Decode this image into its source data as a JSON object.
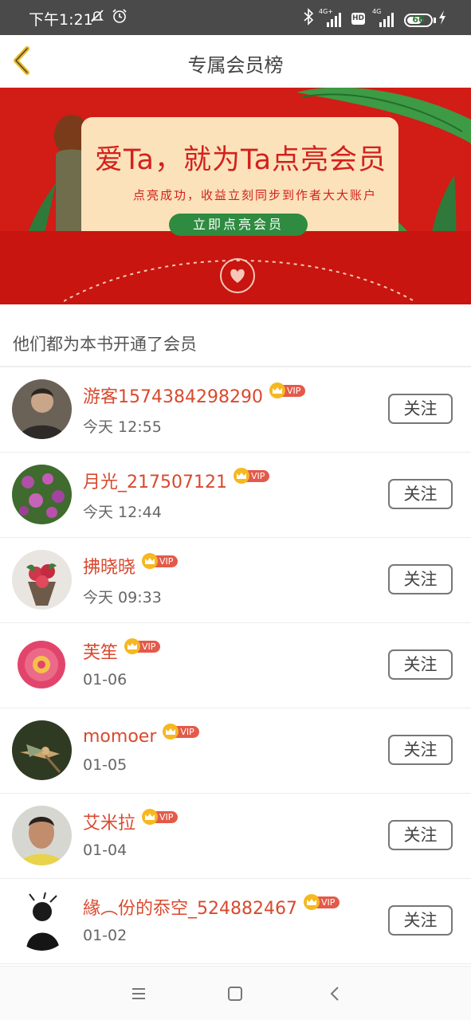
{
  "status_bar": {
    "time": "下午1:21",
    "net_1": "4G+",
    "net_2": "4G",
    "hd": "HD",
    "battery": "66",
    "battery_level": 0.66
  },
  "header": {
    "title": "专属会员榜"
  },
  "banner": {
    "headline": "爱Ta，就为Ta点亮会员",
    "subline": "点亮成功，收益立刻同步到作者大大账户",
    "cta": "立即点亮会员"
  },
  "section_title": "他们都为本书开通了会员",
  "vip_label": "VIP",
  "follow_label": "关注",
  "members": [
    {
      "name": "游客1574384298290",
      "time": "今天 12:55"
    },
    {
      "name": "月光_217507121",
      "time": "今天 12:44"
    },
    {
      "name": "拂晓晓",
      "time": "今天 09:33"
    },
    {
      "name": "芙笙",
      "time": "01-06"
    },
    {
      "name": "momoer",
      "time": "01-05"
    },
    {
      "name": "艾米拉",
      "time": "01-04"
    },
    {
      "name": "緣︵份的忝空_524882467",
      "time": "01-02"
    }
  ],
  "colors": {
    "accent_name": "#d9492e",
    "banner_red": "#d21c16",
    "back_arrow": "#e8b923",
    "cta_green": "#2e8b3f",
    "vip_badge": "#e35a4a",
    "crown": "#f5b820"
  },
  "icons": {
    "back": "chevron-left-icon",
    "bluetooth": "bluetooth-icon",
    "alarm": "alarm-icon",
    "mute": "mute-icon",
    "charging": "bolt-icon",
    "nav_menu": "menu-icon",
    "nav_home": "home-square-icon",
    "nav_back": "back-triangle-icon"
  }
}
